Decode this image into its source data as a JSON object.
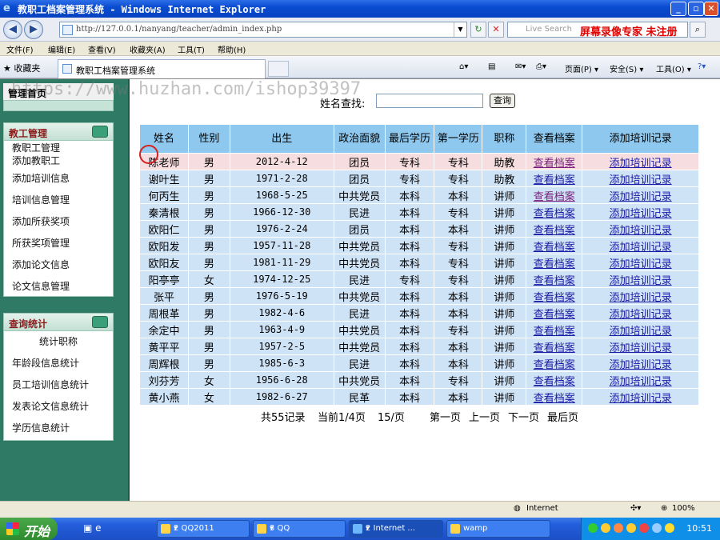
{
  "window": {
    "title": "教职工档案管理系统 - Windows Internet Explorer"
  },
  "browser": {
    "url": "http://127.0.0.1/nanyang/teacher/admin_index.php",
    "search_placeholder": "Live Search",
    "recorder_watermark": "屏幕录像专家 未注册",
    "menu": [
      "文件(F)",
      "编辑(E)",
      "查看(V)",
      "收藏夹(A)",
      "工具(T)",
      "帮助(H)"
    ],
    "favorites_label": "收藏夹",
    "tab_title": "教职工档案管理系统",
    "commands": [
      "页面(P) ▾",
      "安全(S) ▾",
      "工具(O) ▾"
    ],
    "status_zone": "Internet",
    "zoom": "100%"
  },
  "page": {
    "watermark": "https://www.huzhan.com/ishop39397",
    "sidebar": {
      "header": "管理首页",
      "panels": [
        {
          "title": "教工管理",
          "items": [
            "教职工管理",
            "添加教职工",
            "添加培训信息",
            "培训信息管理",
            "添加所获奖项",
            "所获奖项管理",
            "添加论文信息",
            "论文信息管理"
          ]
        },
        {
          "title": "查询统计",
          "items": [
            "统计职称",
            "年龄段信息统计",
            "员工培训信息统计",
            "发表论文信息统计",
            "学历信息统计"
          ]
        }
      ]
    },
    "search": {
      "label": "姓名查找:",
      "button": "查询",
      "value": ""
    },
    "table": {
      "headers": [
        "姓名",
        "性别",
        "出生",
        "政治面貌",
        "最后学历",
        "第一学历",
        "职称",
        "查看档案",
        "添加培训记录"
      ],
      "view_link": "查看档案",
      "train_link": "添加培训记录",
      "rows": [
        [
          "陈老师",
          "男",
          "2012-4-12",
          "团员",
          "专科",
          "专科",
          "助教"
        ],
        [
          "谢叶生",
          "男",
          "1971-2-28",
          "团员",
          "专科",
          "专科",
          "助教"
        ],
        [
          "何丙生",
          "男",
          "1968-5-25",
          "中共党员",
          "本科",
          "本科",
          "讲师"
        ],
        [
          "秦清根",
          "男",
          "1966-12-30",
          "民进",
          "本科",
          "专科",
          "讲师"
        ],
        [
          "欧阳仁",
          "男",
          "1976-2-24",
          "团员",
          "本科",
          "本科",
          "讲师"
        ],
        [
          "欧阳发",
          "男",
          "1957-11-28",
          "中共党员",
          "本科",
          "专科",
          "讲师"
        ],
        [
          "欧阳友",
          "男",
          "1981-11-29",
          "中共党员",
          "本科",
          "专科",
          "讲师"
        ],
        [
          "阳亭亭",
          "女",
          "1974-12-25",
          "民进",
          "专科",
          "专科",
          "讲师"
        ],
        [
          "张平",
          "男",
          "1976-5-19",
          "中共党员",
          "本科",
          "本科",
          "讲师"
        ],
        [
          "周根革",
          "男",
          "1982-4-6",
          "民进",
          "本科",
          "本科",
          "讲师"
        ],
        [
          "余定中",
          "男",
          "1963-4-9",
          "中共党员",
          "本科",
          "专科",
          "讲师"
        ],
        [
          "黄平平",
          "男",
          "1957-2-5",
          "中共党员",
          "本科",
          "本科",
          "讲师"
        ],
        [
          "周辉根",
          "男",
          "1985-6-3",
          "民进",
          "本科",
          "本科",
          "讲师"
        ],
        [
          "刘芬芳",
          "女",
          "1956-6-28",
          "中共党员",
          "本科",
          "专科",
          "讲师"
        ],
        [
          "黄小燕",
          "女",
          "1982-6-27",
          "民革",
          "本科",
          "本科",
          "讲师"
        ]
      ]
    },
    "pager": {
      "total": "共55记录",
      "current": "当前1/4页",
      "per_page": "15/页",
      "first": "第一页",
      "prev": "上一页",
      "next": "下一页",
      "last": "最后页"
    }
  },
  "taskbar": {
    "start": "开始",
    "buttons": [
      "2 QQ2011",
      "3 QQ",
      "2 Internet ...",
      "wamp"
    ],
    "clock": "10:51"
  }
}
